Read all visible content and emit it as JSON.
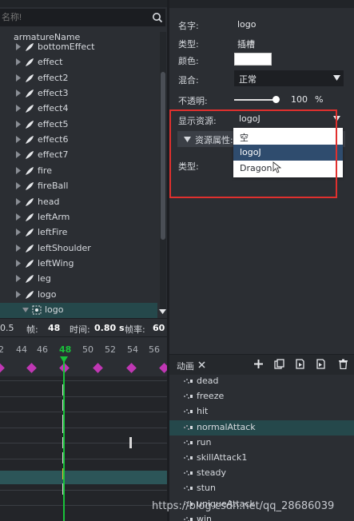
{
  "search": {
    "placeholder": "名称!"
  },
  "tree": {
    "root_label": "armatureName",
    "items": [
      {
        "label": "bottomEffect"
      },
      {
        "label": "effect"
      },
      {
        "label": "effect2"
      },
      {
        "label": "effect3"
      },
      {
        "label": "effect4"
      },
      {
        "label": "effect5"
      },
      {
        "label": "effect6"
      },
      {
        "label": "effect7"
      },
      {
        "label": "fire"
      },
      {
        "label": "fireBall"
      },
      {
        "label": "head"
      },
      {
        "label": "leftArm"
      },
      {
        "label": "leftFire"
      },
      {
        "label": "leftShoulder"
      },
      {
        "label": "leftWing"
      },
      {
        "label": "leg"
      },
      {
        "label": "logo"
      }
    ],
    "selected_child": "logo"
  },
  "timebar": {
    "left_value": "0.5",
    "frame_label": "帧:",
    "frame_value": "48",
    "time_label": "时间:",
    "time_value": "0.80 s",
    "fps_label": "帧率:",
    "fps_value": "60"
  },
  "ruler": {
    "ticks": [
      "2",
      "44",
      "46",
      "48",
      "50",
      "52",
      "54",
      "56"
    ],
    "current": "48"
  },
  "properties": {
    "name_label": "名字:",
    "name_value": "logo",
    "type_label": "类型:",
    "type_value": "插槽",
    "color_label": "颜色:",
    "color_value": "#ffffff",
    "blend_label": "混合:",
    "blend_value": "正常",
    "opacity_label": "不透明:",
    "opacity_value": "100",
    "opacity_unit": "%",
    "opacity_fraction": 1.0,
    "display_label": "显示资源:",
    "display_value": "logoJ",
    "resprops_label": "资源属性:",
    "res_type_label": "类型:",
    "dropdown_options": [
      {
        "label": "空"
      },
      {
        "label": "logoJ"
      },
      {
        "label": "Dragon"
      }
    ],
    "dropdown_selected": "logoJ"
  },
  "animation": {
    "tab_label": "动画",
    "items": [
      {
        "label": "dead"
      },
      {
        "label": "freeze"
      },
      {
        "label": "hit"
      },
      {
        "label": "normalAttack"
      },
      {
        "label": "run"
      },
      {
        "label": "skillAttack1"
      },
      {
        "label": "steady"
      },
      {
        "label": "stun"
      },
      {
        "label": "uniqueAttack"
      },
      {
        "label": "win"
      }
    ],
    "selected": "normalAttack"
  },
  "watermark": "https://blog.csdn.net/qq_28686039",
  "colors": {
    "accent_playhead": "#19c23a",
    "keyframe": "#c037b4",
    "selection": "#25484b",
    "highlight_box": "#e0302e"
  }
}
